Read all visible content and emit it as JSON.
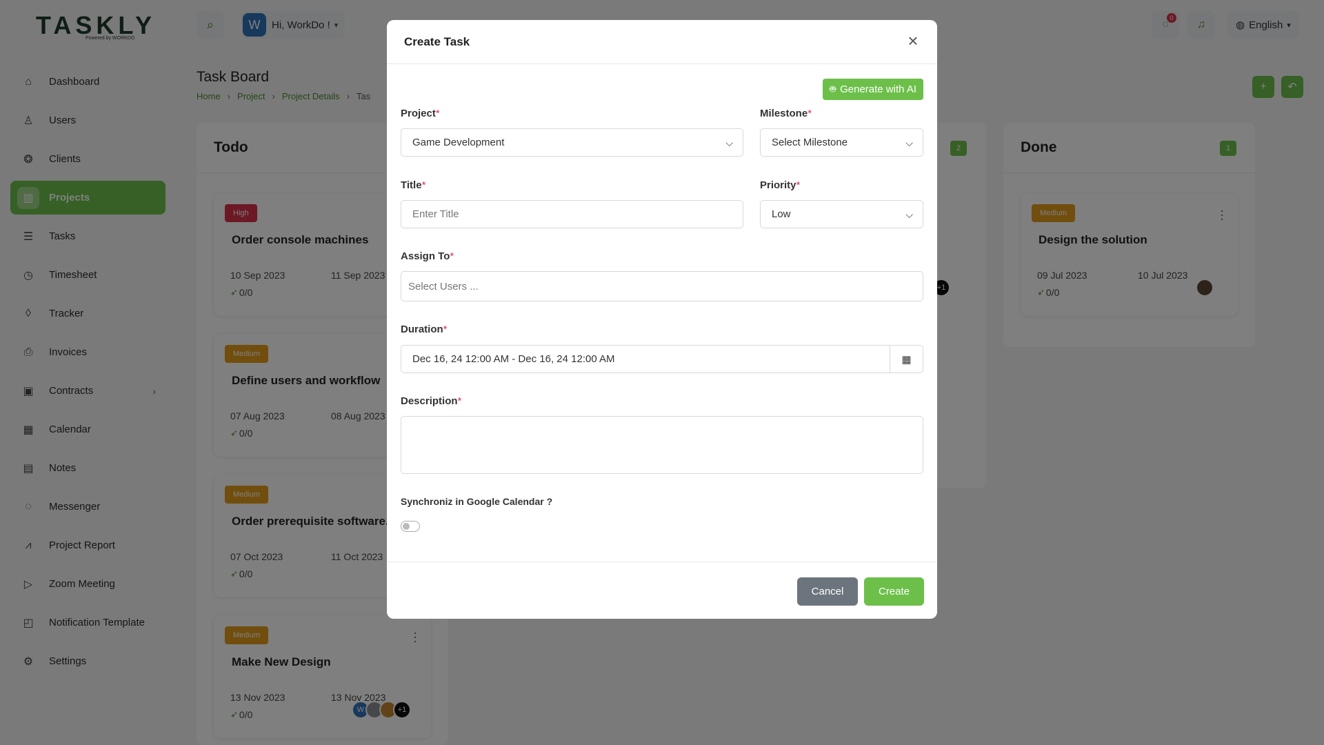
{
  "app": {
    "logo_text": "TASKLY",
    "logo_sub": "Powered by WORKDO"
  },
  "header": {
    "greeting": "Hi, WorkDo !",
    "avatar_letter": "W",
    "message_count": "0",
    "language": "English"
  },
  "sidebar": {
    "items": [
      {
        "label": "Dashboard",
        "icon": "home-icon"
      },
      {
        "label": "Users",
        "icon": "user-icon"
      },
      {
        "label": "Clients",
        "icon": "clients-icon"
      },
      {
        "label": "Projects",
        "icon": "projects-icon",
        "active": true
      },
      {
        "label": "Tasks",
        "icon": "list-icon"
      },
      {
        "label": "Timesheet",
        "icon": "clock-icon"
      },
      {
        "label": "Tracker",
        "icon": "tracker-icon"
      },
      {
        "label": "Invoices",
        "icon": "printer-icon"
      },
      {
        "label": "Contracts",
        "icon": "contract-icon"
      },
      {
        "label": "Calendar",
        "icon": "calendar-icon"
      },
      {
        "label": "Notes",
        "icon": "clipboard-icon"
      },
      {
        "label": "Messenger",
        "icon": "chat-icon"
      },
      {
        "label": "Project Report",
        "icon": "chart-icon"
      },
      {
        "label": "Zoom Meeting",
        "icon": "video-icon"
      },
      {
        "label": "Notification Template",
        "icon": "notification-icon"
      },
      {
        "label": "Settings",
        "icon": "gear-icon"
      }
    ]
  },
  "page": {
    "title": "Task Board",
    "breadcrumb": [
      "Home",
      "Project",
      "Project Details",
      "Tas"
    ]
  },
  "board": {
    "todo": {
      "title": "Todo",
      "cards": [
        {
          "tag": "High",
          "title": "Order console machines",
          "start": "10 Sep 2023",
          "end": "11 Sep 2023",
          "progress": "0/0"
        },
        {
          "tag": "Medium",
          "title": "Define users and workflow",
          "start": "07 Aug 2023",
          "end": "08 Aug 2023",
          "progress": "0/0"
        },
        {
          "tag": "Medium",
          "title": "Order prerequisite software.",
          "start": "07 Oct 2023",
          "end": "11 Oct 2023",
          "progress": "0/0"
        },
        {
          "tag": "Medium",
          "title": "Make New Design",
          "start": "13 Nov 2023",
          "end": "13 Nov 2023",
          "progress": "0/0",
          "avatar_more": "+1"
        }
      ]
    },
    "middle": {
      "count": "2",
      "avatar_more": "+1"
    },
    "done": {
      "title": "Done",
      "count": "1",
      "cards": [
        {
          "tag": "Medium",
          "title": "Design the solution",
          "start": "09 Jul 2023",
          "end": "10 Jul 2023",
          "progress": "0/0"
        }
      ]
    }
  },
  "modal": {
    "title": "Create Task",
    "ai_button": "Generate with AI",
    "project": {
      "label": "Project",
      "value": "Game Development"
    },
    "milestone": {
      "label": "Milestone",
      "value": "Select Milestone"
    },
    "title_field": {
      "label": "Title",
      "placeholder": "Enter Title"
    },
    "priority": {
      "label": "Priority",
      "value": "Low"
    },
    "assign_to": {
      "label": "Assign To",
      "placeholder": "Select Users ..."
    },
    "duration": {
      "label": "Duration",
      "value": "Dec 16, 24 12:00 AM - Dec 16, 24 12:00 AM"
    },
    "description": {
      "label": "Description"
    },
    "sync": {
      "label": "Synchroniz in Google Calendar ?",
      "enabled": false
    },
    "cancel": "Cancel",
    "create": "Create"
  },
  "colors": {
    "accent": "#6cc04a",
    "high": "#d9304a",
    "medium": "#e39c1b",
    "cancel": "#6c757d"
  }
}
